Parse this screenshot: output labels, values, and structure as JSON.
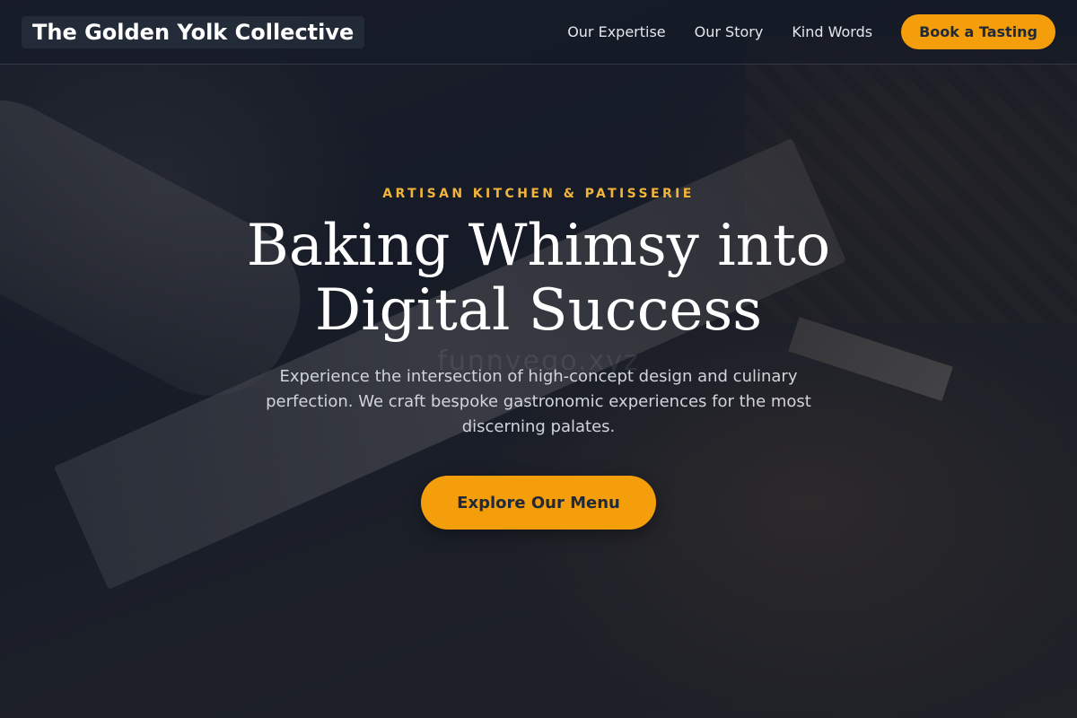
{
  "nav": {
    "brand": "The Golden Yolk Collective",
    "links": [
      "Our Expertise",
      "Our Story",
      "Kind Words"
    ],
    "cta_label": "Book a Tasting"
  },
  "hero": {
    "eyebrow": "ARTISAN KITCHEN & PATISSERIE",
    "headline": "Baking Whimsy into Digital Success",
    "subheading": "Experience the intersection of high-concept design and culinary perfection. We craft bespoke gastronomic experiences for the most discerning palates.",
    "cta_label": "Explore Our Menu"
  },
  "watermark": "funnyego.xyz",
  "colors": {
    "accent": "#f59e0b",
    "eyebrow": "#f2b43a",
    "overlay": "#111827"
  }
}
